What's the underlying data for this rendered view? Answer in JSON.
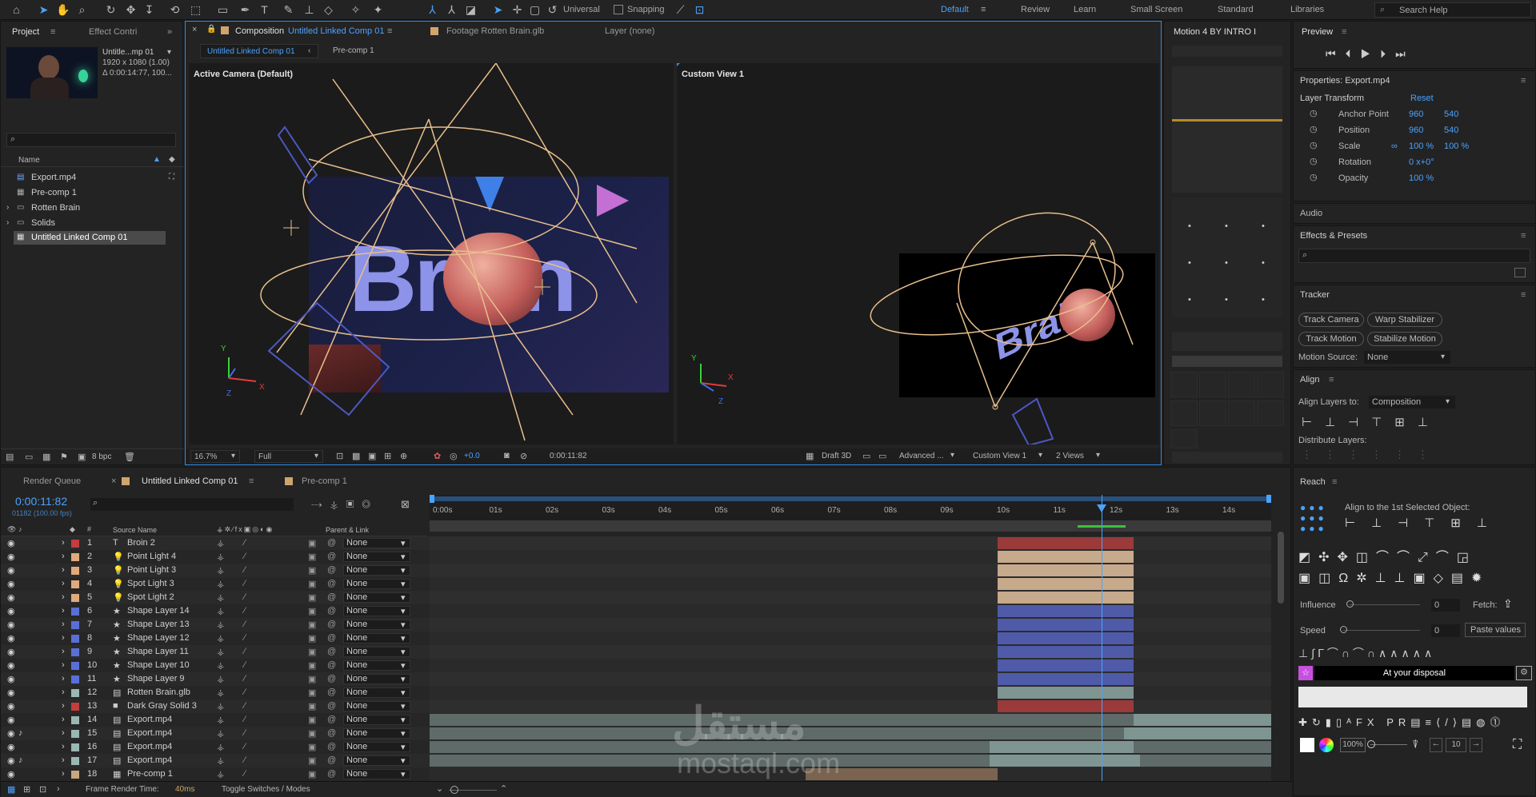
{
  "toolbar": {
    "universal": "Universal",
    "snapping": "Snapping",
    "workspaces": [
      "Default",
      "Review",
      "Learn",
      "Standard",
      "Small Screen",
      "Libraries"
    ],
    "search": "Search Help"
  },
  "project": {
    "tab": "Project",
    "tab2": "Effect Contri",
    "thumb_name": "Untitle...mp 01",
    "thumb_size": "1920 x 1080 (1.00)",
    "thumb_dur": "Δ 0:00:14:77, 100...",
    "col_name": "Name",
    "items": [
      "Export.mp4",
      "Pre-comp 1",
      "Rotten Brain",
      "Solids",
      "Untitled Linked Comp 01"
    ],
    "bpc": "8 bpc"
  },
  "comp": {
    "tab": "Composition",
    "comp_name": "Untitled Linked Comp 01",
    "footage": "Footage Rotten Brain.glb",
    "layer": "Layer (none)",
    "breadcrumb1": "Untitled Linked Comp 01",
    "breadcrumb2": "Pre-comp 1",
    "view_left": "Active Camera (Default)",
    "view_right": "Custom View 1",
    "zoom": "16.7%",
    "res": "Full",
    "exposure": "+0.0",
    "timecode": "0:00:11:82",
    "draft": "Draft 3D",
    "renderer": "Advanced ...",
    "view_select": "Custom View 1",
    "views": "2 Views",
    "left_text": "Brain",
    "right_text": "Brain"
  },
  "motion": {
    "title": "Motion 4 BY INTRO I"
  },
  "preview": {
    "title": "Preview"
  },
  "properties": {
    "title": "Properties: Export.mp4",
    "section": "Layer Transform",
    "reset": "Reset",
    "rows": [
      {
        "label": "Anchor Point",
        "v1": "960",
        "v2": "540"
      },
      {
        "label": "Position",
        "v1": "960",
        "v2": "540"
      },
      {
        "label": "Scale",
        "v1": "100 %",
        "v2": "100 %"
      },
      {
        "label": "Rotation",
        "v1": "0 x+0°",
        "v2": ""
      },
      {
        "label": "Opacity",
        "v1": "100 %",
        "v2": ""
      }
    ],
    "audio": "Audio"
  },
  "effects": {
    "title": "Effects & Presets"
  },
  "tracker": {
    "title": "Tracker",
    "buttons": [
      "Track Camera",
      "Warp Stabilizer",
      "Track Motion",
      "Stabilize Motion"
    ],
    "motion_source_label": "Motion Source:",
    "motion_source": "None"
  },
  "align": {
    "title": "Align",
    "align_to_label": "Align Layers to:",
    "align_to": "Composition",
    "distribute": "Distribute Layers:"
  },
  "reach": {
    "title": "Reach",
    "align_first": "Align to the 1st Selected Object:",
    "influence": "Influence",
    "influence_val": "0",
    "fetch": "Fetch:",
    "speed": "Speed",
    "speed_val": "0",
    "paste": "Paste values",
    "disposal": "At your disposal",
    "zoom": "100%",
    "num": "10"
  },
  "timeline": {
    "render_queue": "Render Queue",
    "comp_tab": "Untitled Linked Comp 01",
    "precomp_tab": "Pre-comp 1",
    "timecode": "0:00:11:82",
    "frames": "01182 (100.00 fps)",
    "col_source": "Source Name",
    "col_parent": "Parent & Link",
    "frame_render": "Frame Render Time:",
    "frame_render_val": "40ms",
    "toggle": "Toggle Switches / Modes",
    "ruler": [
      "0:00s",
      "01s",
      "02s",
      "03s",
      "04s",
      "05s",
      "06s",
      "07s",
      "08s",
      "09s",
      "10s",
      "11s",
      "12s",
      "13s",
      "14s"
    ],
    "layers": [
      {
        "num": "1",
        "name": "Broin 2",
        "color": "#c23d3d",
        "parent": "None"
      },
      {
        "num": "2",
        "name": "Point Light 4",
        "color": "#e2a97c",
        "parent": "None"
      },
      {
        "num": "3",
        "name": "Point Light 3",
        "color": "#e2a97c",
        "parent": "None"
      },
      {
        "num": "4",
        "name": "Spot Light 3",
        "color": "#e2a97c",
        "parent": "None"
      },
      {
        "num": "5",
        "name": "Spot Light 2",
        "color": "#e2a97c",
        "parent": "None"
      },
      {
        "num": "6",
        "name": "Shape Layer 14",
        "color": "#5a6fd6",
        "parent": "None"
      },
      {
        "num": "7",
        "name": "Shape Layer 13",
        "color": "#5a6fd6",
        "parent": "None"
      },
      {
        "num": "8",
        "name": "Shape Layer 12",
        "color": "#5a6fd6",
        "parent": "None"
      },
      {
        "num": "9",
        "name": "Shape Layer 11",
        "color": "#5a6fd6",
        "parent": "None"
      },
      {
        "num": "10",
        "name": "Shape Layer 10",
        "color": "#5a6fd6",
        "parent": "None"
      },
      {
        "num": "11",
        "name": "Shape Layer 9",
        "color": "#5a6fd6",
        "parent": "None"
      },
      {
        "num": "12",
        "name": "Rotten Brain.glb",
        "color": "#9ab7b2",
        "parent": "None"
      },
      {
        "num": "13",
        "name": "Dark Gray Solid 3",
        "color": "#c23d3d",
        "parent": "None"
      },
      {
        "num": "14",
        "name": "Export.mp4",
        "color": "#9ab7b2",
        "parent": "None"
      },
      {
        "num": "15",
        "name": "Export.mp4",
        "color": "#9ab7b2",
        "parent": "None"
      },
      {
        "num": "16",
        "name": "Export.mp4",
        "color": "#9ab7b2",
        "parent": "None"
      },
      {
        "num": "17",
        "name": "Export.mp4",
        "color": "#9ab7b2",
        "parent": "None"
      },
      {
        "num": "18",
        "name": "Pre-comp 1",
        "color": "#c8a67e",
        "parent": "None"
      }
    ]
  },
  "watermark": {
    "arabic": "مستقل",
    "latin": "mostaql.com"
  },
  "colors": {
    "accent": "#2d8ceb",
    "panel": "#232323"
  }
}
